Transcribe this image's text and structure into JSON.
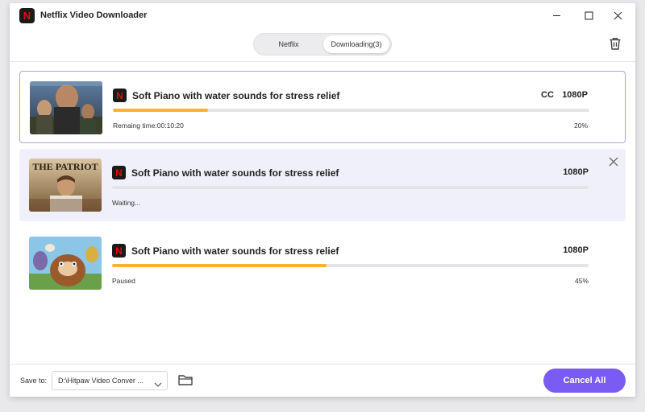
{
  "window": {
    "title": "Netflix Video Downloader",
    "icons": {
      "logo": "netflix-logo-icon",
      "minimize": "minimize-icon",
      "maximize": "maximize-icon",
      "close": "close-icon"
    }
  },
  "tabs": [
    {
      "label": "Netflix",
      "active": false
    },
    {
      "label": "Downloading(3)",
      "active": true
    }
  ],
  "toolbar": {
    "trash_icon": "trash-icon"
  },
  "downloads": [
    {
      "title": "Soft Piano with water sounds for stress relief",
      "cc": "CC",
      "quality": "1080P",
      "progress": 0.2,
      "status": "Remaing time:00:10:20",
      "percent": "20%",
      "thumbnail": "action-movie-poster"
    },
    {
      "title": "Soft Piano with water sounds for stress relief",
      "quality": "1080P",
      "progress": 0,
      "status": "Waiting...",
      "thumbnail": "the-patriot-poster",
      "thumbnail_text": "THE PATRIOT"
    },
    {
      "title": "Soft Piano with water sounds for stress relief",
      "quality": "1080P",
      "progress": 0.45,
      "status": "Paused",
      "percent": "45%",
      "thumbnail": "animated-movie-poster"
    }
  ],
  "footer": {
    "save_to_label": "Save to:",
    "save_path": "D:\\Hitpaw Video Conver ...",
    "folder_icon": "folder-icon",
    "cancel_all_label": "Cancel All"
  },
  "colors": {
    "accent": "#7a5cf2",
    "progress": "#f7b32b",
    "selected_border": "#a9a7d8",
    "waiting_row_bg": "#f0f0fa",
    "netflix_red": "#e50914"
  }
}
